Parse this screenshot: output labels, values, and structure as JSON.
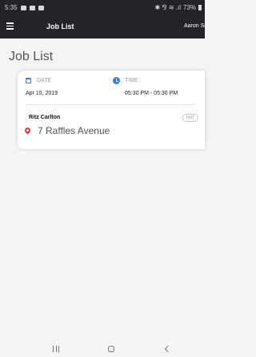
{
  "status_bar": {
    "time": "5:35",
    "indicators": "✱ ⅋ ≋ .ıl",
    "battery": "73%",
    "icons": [
      "gallery-icon",
      "notification-icon",
      "notification-icon",
      "bluetooth-icon",
      "volte-icon",
      "wifi-icon",
      "signal-icon",
      "battery-icon"
    ]
  },
  "app_bar": {
    "menu_icon": "hamburger-menu-icon",
    "title": "Job List",
    "user_name": "Aaron So"
  },
  "page": {
    "heading": "Job List"
  },
  "jobs": [
    {
      "date_label": "DATE",
      "date": "Apr 15, 2019",
      "time_label": "TIME",
      "time": "05:30 PM - 05:30 PM",
      "venue": "Ritz Carlton",
      "status": "OUT",
      "address": "7 Raffles Avenue",
      "icons": [
        "calendar-icon",
        "clock-icon",
        "location-pin-icon"
      ]
    }
  ],
  "colors": {
    "app_bar": "#232328",
    "background": "#f4f4f4",
    "accent_blue": "#3b7fd2",
    "pin_red": "#d93b3b"
  },
  "nav_bar": {
    "recents": "|||",
    "home": "○",
    "back": "<",
    "icons": [
      "recents-icon",
      "home-icon",
      "back-icon"
    ]
  }
}
